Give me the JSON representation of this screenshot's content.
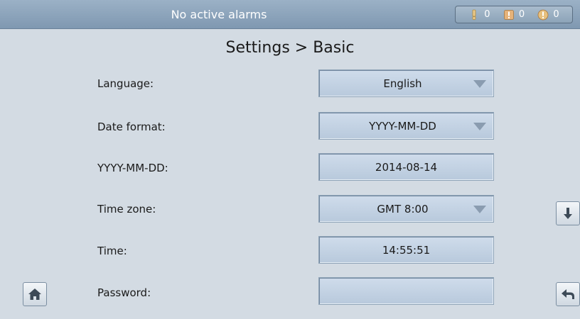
{
  "status_bar": {
    "alarm_text": "No active alarms",
    "counters": [
      {
        "icon": "minor-alarm-icon",
        "count": "0"
      },
      {
        "icon": "major-alarm-icon",
        "count": "0"
      },
      {
        "icon": "critical-alarm-icon",
        "count": "0"
      }
    ]
  },
  "page": {
    "title": "Settings > Basic"
  },
  "settings": [
    {
      "label": "Language:",
      "value": "English",
      "type": "dropdown"
    },
    {
      "label": "Date format:",
      "value": "YYYY-MM-DD",
      "type": "dropdown"
    },
    {
      "label": "YYYY-MM-DD:",
      "value": "2014-08-14",
      "type": "field"
    },
    {
      "label": "Time zone:",
      "value": "GMT 8:00",
      "type": "dropdown"
    },
    {
      "label": "Time:",
      "value": "14:55:51",
      "type": "field"
    },
    {
      "label": "Password:",
      "value": "",
      "type": "field"
    }
  ],
  "buttons": {
    "home": "home-icon",
    "scroll_down": "arrow-down-icon",
    "back": "back-arrow-icon"
  },
  "colors": {
    "background": "#d3dbe3",
    "status_bar": "#8ca3b8",
    "field": "#c4d3e4"
  }
}
